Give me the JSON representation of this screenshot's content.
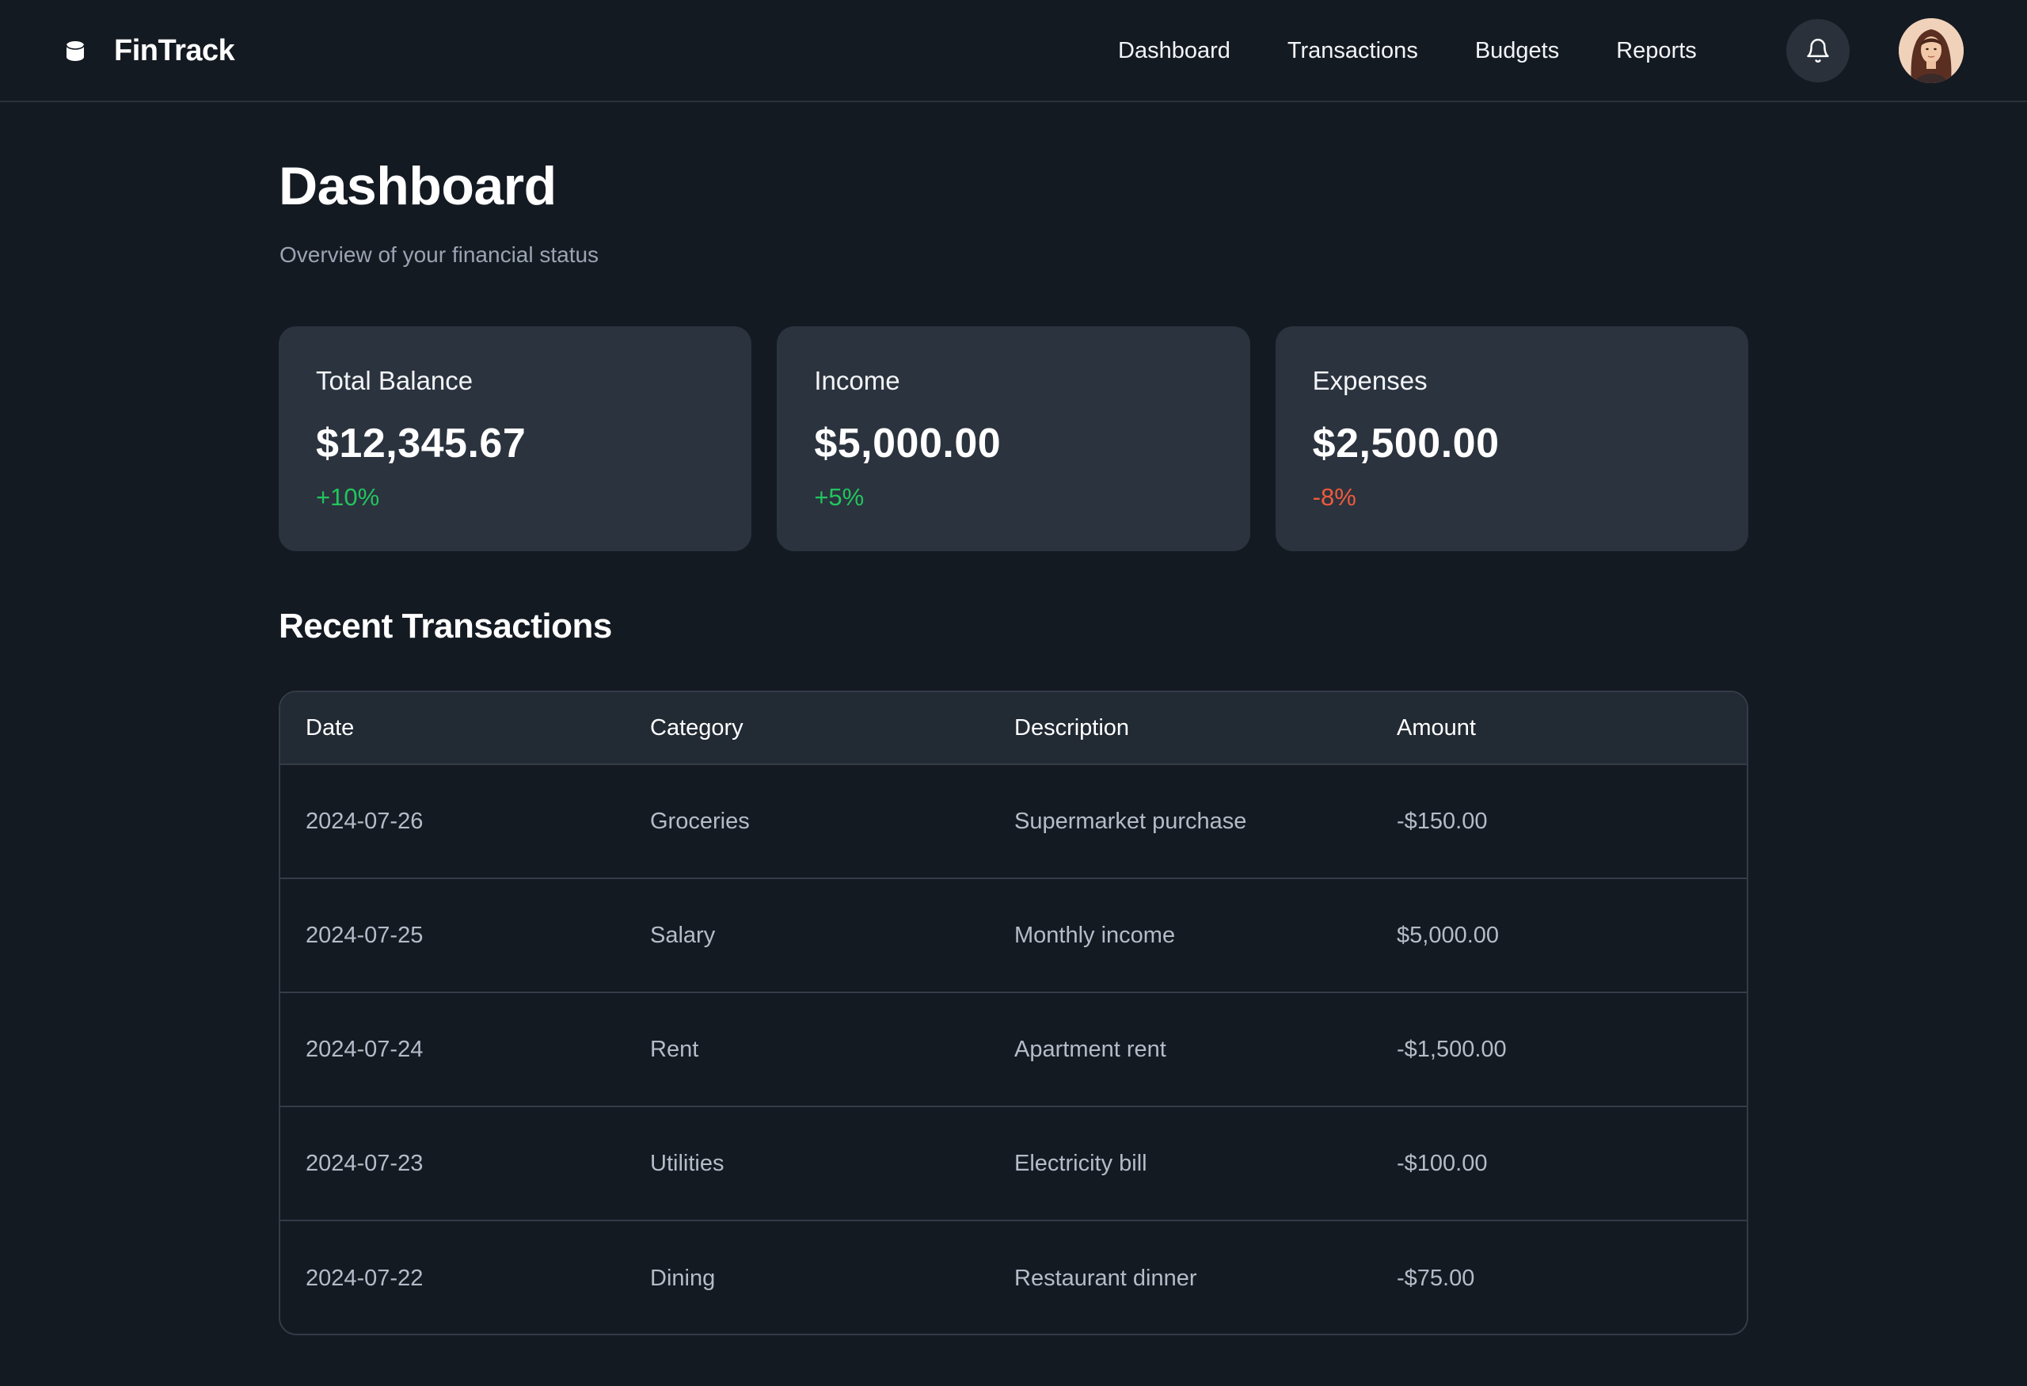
{
  "brand": {
    "name": "FinTrack"
  },
  "nav": {
    "items": [
      "Dashboard",
      "Transactions",
      "Budgets",
      "Reports"
    ]
  },
  "header": {
    "title": "Dashboard",
    "subtitle": "Overview of your financial status"
  },
  "cards": [
    {
      "label": "Total Balance",
      "value": "$12,345.67",
      "change": "+10%",
      "trend": "up",
      "color": "#22c55e"
    },
    {
      "label": "Income",
      "value": "$5,000.00",
      "change": "+5%",
      "trend": "up",
      "color": "#22c55e"
    },
    {
      "label": "Expenses",
      "value": "$2,500.00",
      "change": "-8%",
      "trend": "down",
      "color": "#ef5a3c"
    }
  ],
  "transactions": {
    "title": "Recent Transactions",
    "columns": [
      "Date",
      "Category",
      "Description",
      "Amount"
    ],
    "rows": [
      {
        "date": "2024-07-26",
        "category": "Groceries",
        "description": "Supermarket purchase",
        "amount": "-$150.00"
      },
      {
        "date": "2024-07-25",
        "category": "Salary",
        "description": "Monthly income",
        "amount": "$5,000.00"
      },
      {
        "date": "2024-07-24",
        "category": "Rent",
        "description": "Apartment rent",
        "amount": "-$1,500.00"
      },
      {
        "date": "2024-07-23",
        "category": "Utilities",
        "description": "Electricity bill",
        "amount": "-$100.00"
      },
      {
        "date": "2024-07-22",
        "category": "Dining",
        "description": "Restaurant dinner",
        "amount": "-$75.00"
      }
    ]
  },
  "icons": {
    "brand": "coin-stack-icon",
    "notifications": "bell-icon",
    "avatar": "user-avatar"
  },
  "colors": {
    "background": "#141a22",
    "card": "#2b333e",
    "positive": "#22c55e",
    "negative": "#ef5a3c"
  }
}
